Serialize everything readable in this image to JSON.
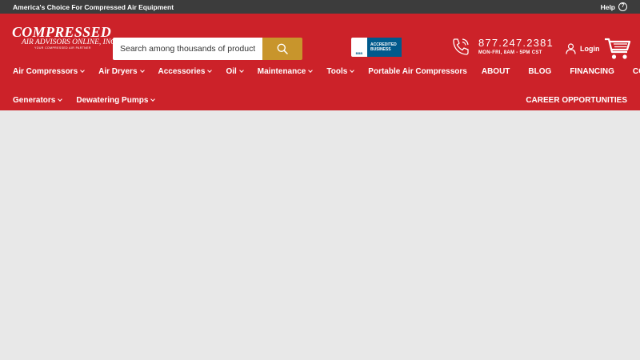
{
  "topbar": {
    "tagline": "America's Choice For Compressed Air Equipment",
    "help_label": "Help",
    "help_glyph": "?"
  },
  "logo": {
    "line1": "COMPRESSED",
    "line2": "AIR ADVISORS ONLINE, INC.",
    "line3": "YOUR COMPRESSED AIR PARTNER"
  },
  "search": {
    "placeholder": "Search among thousands of products ...."
  },
  "bbb": {
    "seal": "BBB",
    "line1": "ACCREDITED",
    "line2": "BUSINESS"
  },
  "contact": {
    "phone": "877.247.2381",
    "hours": "MON-FRI, 8AM - 5PM CST"
  },
  "login_label": "Login",
  "nav_primary": [
    {
      "label": "Air Compressors",
      "dropdown": true
    },
    {
      "label": "Air Dryers",
      "dropdown": true
    },
    {
      "label": "Accessories",
      "dropdown": true
    },
    {
      "label": "Oil",
      "dropdown": true
    },
    {
      "label": "Maintenance",
      "dropdown": true
    },
    {
      "label": "Tools",
      "dropdown": true
    },
    {
      "label": "Portable Air Compressors",
      "dropdown": false
    }
  ],
  "nav_secondary": [
    {
      "label": "Generators",
      "dropdown": true
    },
    {
      "label": "Dewatering Pumps",
      "dropdown": true
    }
  ],
  "nav_right_primary": [
    "ABOUT",
    "BLOG",
    "FINANCING",
    "CONTACT"
  ],
  "nav_right_secondary": [
    "CAREER OPPORTUNITIES"
  ],
  "colors": {
    "header_red": "#cc2229",
    "topbar_dark": "#3c3c3c",
    "search_gold": "#c8952c",
    "bbb_blue": "#005a8c",
    "page_bg": "#e8e8e8"
  }
}
